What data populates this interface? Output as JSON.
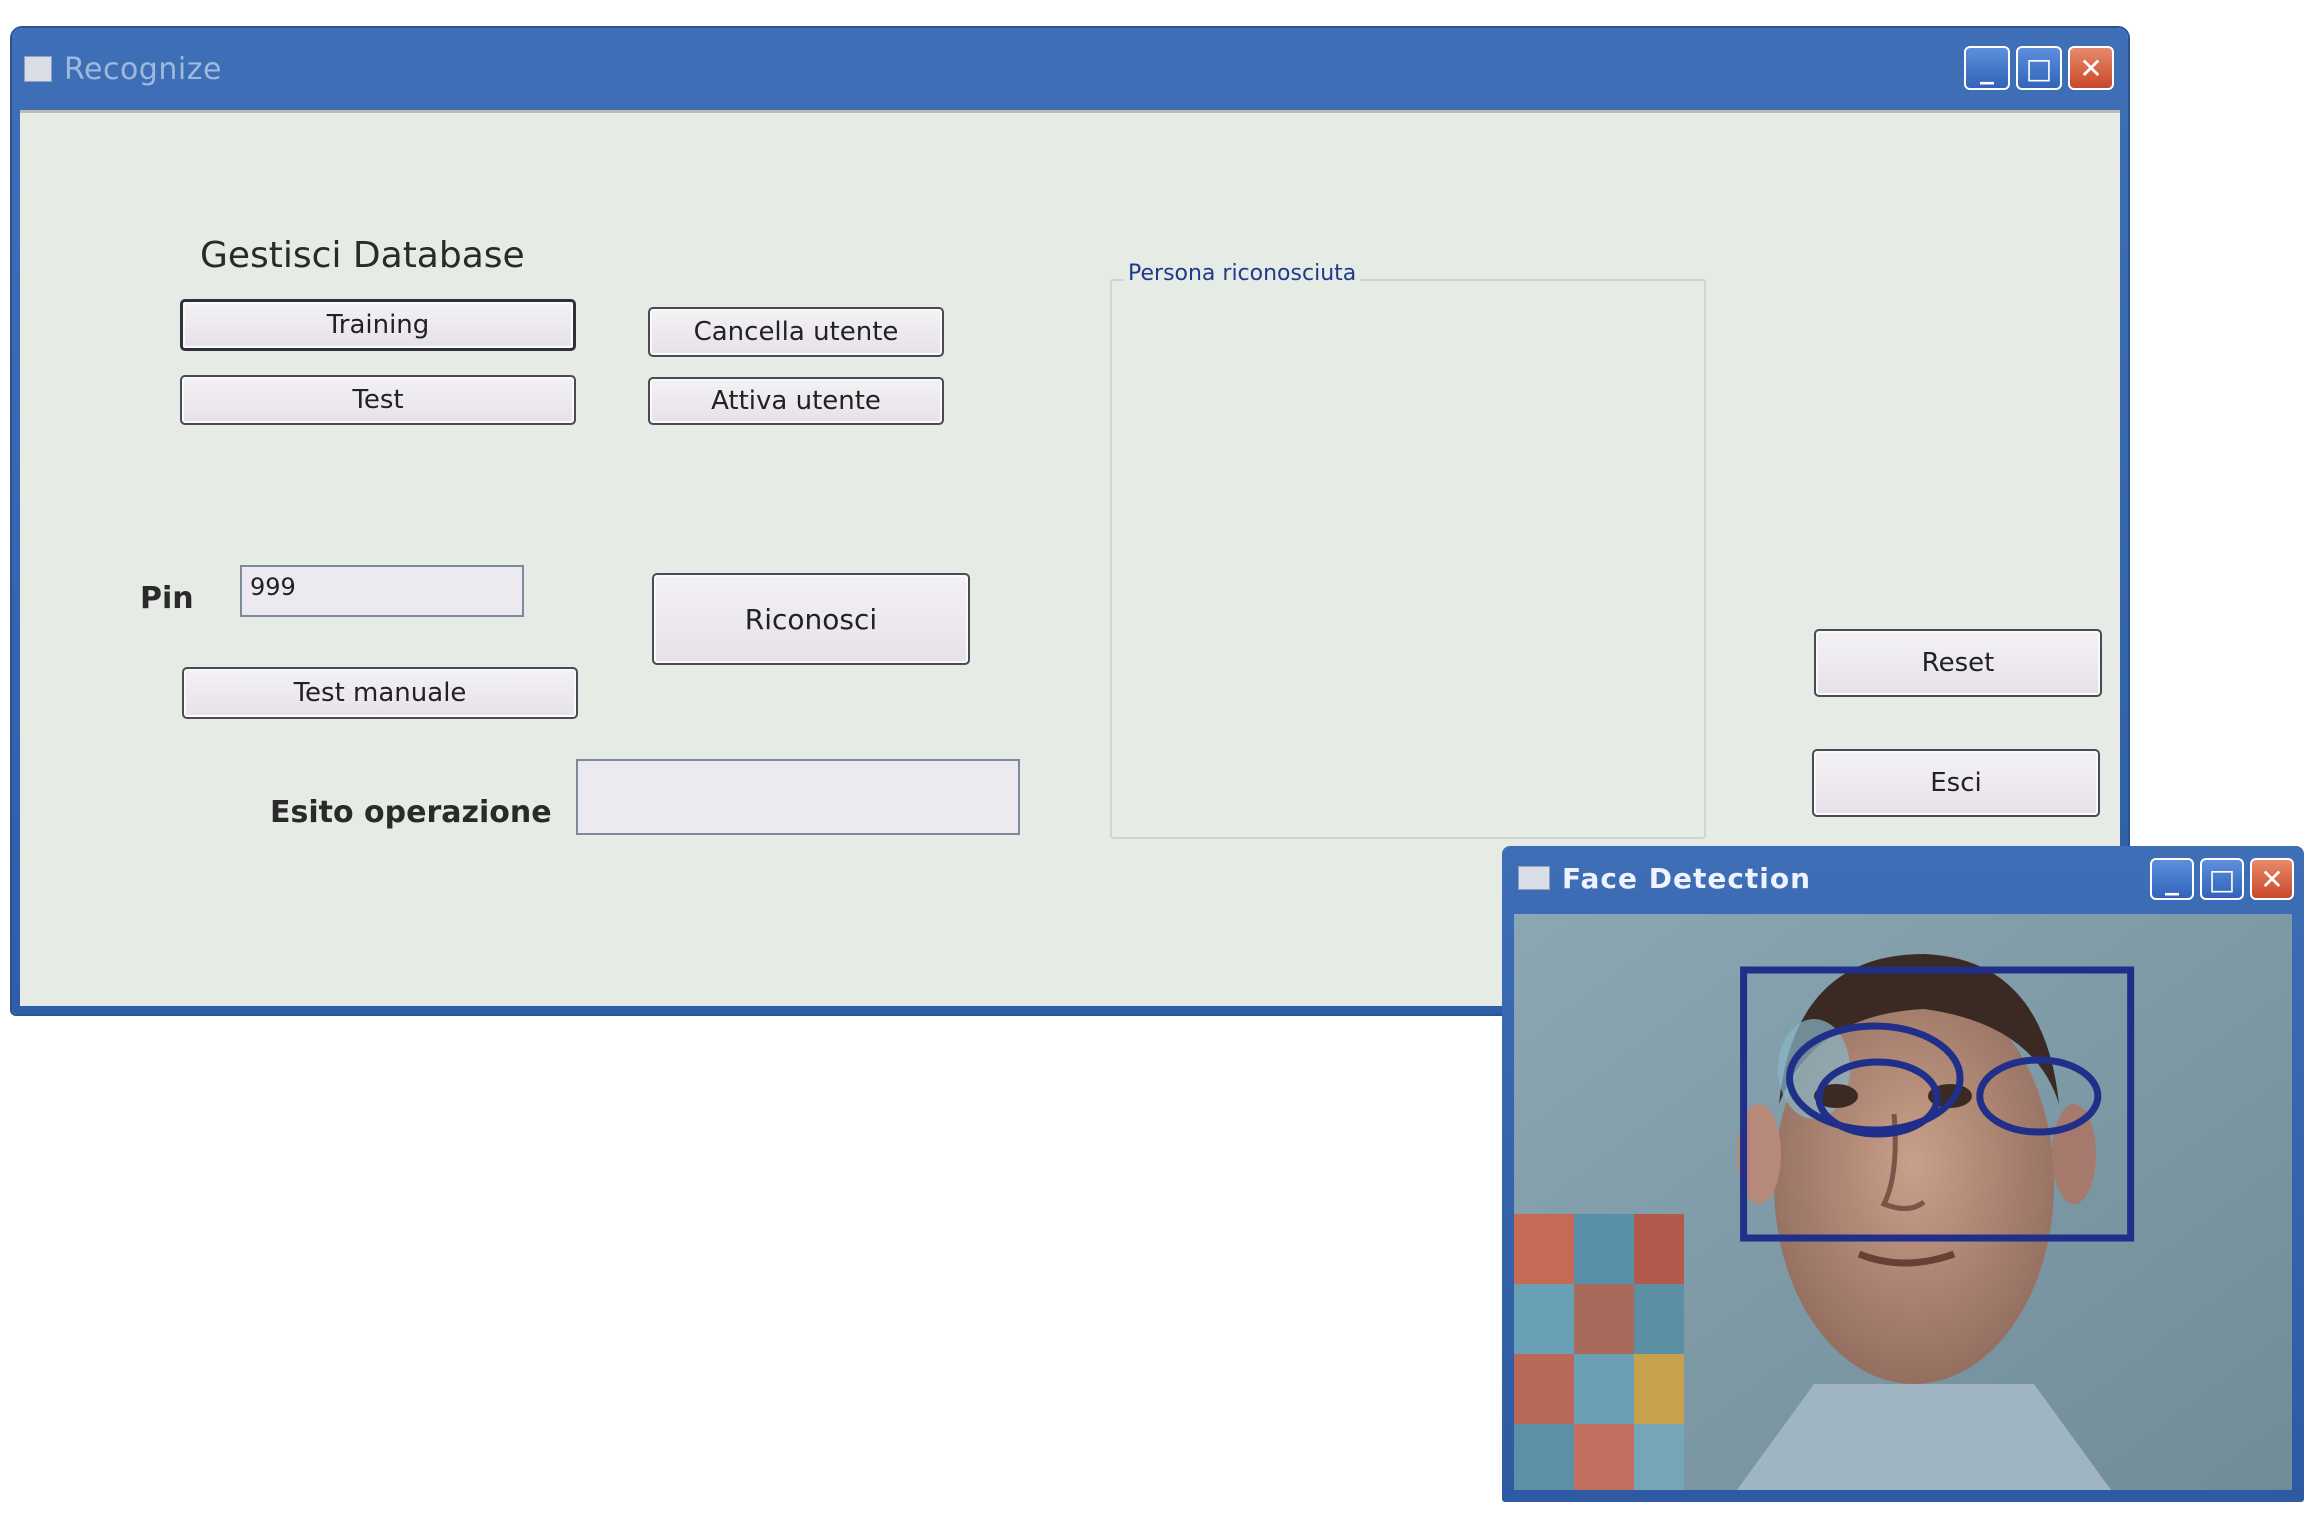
{
  "main_window": {
    "title": "Recognize",
    "controls": {
      "minimize": "_",
      "maximize": "□",
      "close": "✕"
    }
  },
  "form": {
    "section_title": "Gestisci Database",
    "buttons": {
      "training": "Training",
      "test": "Test",
      "cancella_utente": "Cancella utente",
      "attiva_utente": "Attiva utente",
      "riconosci": "Riconosci",
      "test_manuale": "Test manuale",
      "reset": "Reset",
      "esci": "Esci"
    },
    "pin": {
      "label": "Pin",
      "value": "999"
    },
    "esito": {
      "label": "Esito operazione",
      "value": ""
    },
    "recognized_group": {
      "label": "Persona riconosciuta"
    }
  },
  "face_window": {
    "title": "Face Detection",
    "controls": {
      "minimize": "_",
      "maximize": "□",
      "close": "✕"
    },
    "detection_color": "#1f2f8a"
  }
}
